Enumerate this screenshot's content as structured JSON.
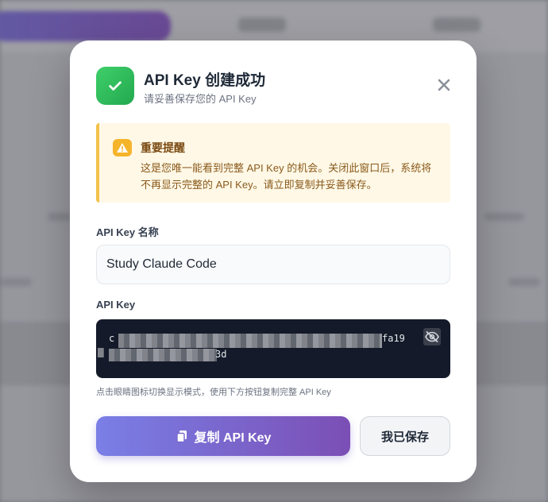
{
  "dialog": {
    "title": "API Key 创建成功",
    "subtitle": "请妥善保存您的 API Key",
    "success_icon": "check-icon",
    "close_icon": "close-icon"
  },
  "warning": {
    "title": "重要提醒",
    "text": "这是您唯一能看到完整 API Key 的机会。关闭此窗口后，系统将不再显示完整的 API Key。请立即复制并妥善保存。",
    "icon": "warning-icon"
  },
  "name_field": {
    "label": "API Key 名称",
    "value": "Study Claude Code"
  },
  "key_field": {
    "label": "API Key",
    "line1_start": "c",
    "line1_end": "fa19",
    "line2_end": "3d",
    "toggle_icon": "eye-slash-icon",
    "hint": "点击眼睛图标切换显示模式，使用下方按钮复制完整 API Key"
  },
  "actions": {
    "copy_label": "复制 API Key",
    "copy_icon": "copy-icon",
    "saved_label": "我已保存"
  }
}
